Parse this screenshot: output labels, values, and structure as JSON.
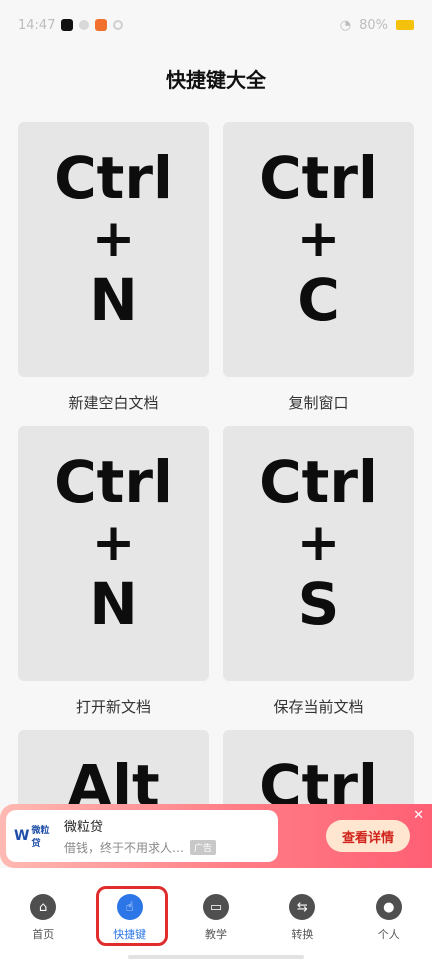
{
  "status_bar": {
    "time": "14:47",
    "battery": "80%"
  },
  "page": {
    "title": "快捷键大全"
  },
  "cards": [
    {
      "keys": [
        "Ctrl",
        "+",
        "N"
      ],
      "label": "新建空白文档"
    },
    {
      "keys": [
        "Ctrl",
        "+",
        "C"
      ],
      "label": "复制窗口"
    },
    {
      "keys": [
        "Ctrl",
        "+",
        "N"
      ],
      "label": "打开新文档"
    },
    {
      "keys": [
        "Ctrl",
        "+",
        "S"
      ],
      "label": "保存当前文档"
    },
    {
      "keys": [
        "Alt"
      ],
      "label": ""
    },
    {
      "keys": [
        "Ctrl"
      ],
      "label": ""
    }
  ],
  "ad": {
    "brand": "微粒贷",
    "title": "微粒贷",
    "desc": "借钱，终于不用求人…",
    "tag": "广告",
    "cta": "查看详情",
    "close": "✕"
  },
  "nav": {
    "items": [
      {
        "label": "首页",
        "icon": "home-icon",
        "active": false
      },
      {
        "label": "快捷键",
        "icon": "tap-icon",
        "active": true
      },
      {
        "label": "教学",
        "icon": "teach-icon",
        "active": false
      },
      {
        "label": "转换",
        "icon": "convert-icon",
        "active": false
      },
      {
        "label": "个人",
        "icon": "user-icon",
        "active": false
      }
    ]
  },
  "colors": {
    "accent": "#2c76e8",
    "highlight_border": "#e02c2c",
    "card_bg": "#e6e6e6"
  }
}
